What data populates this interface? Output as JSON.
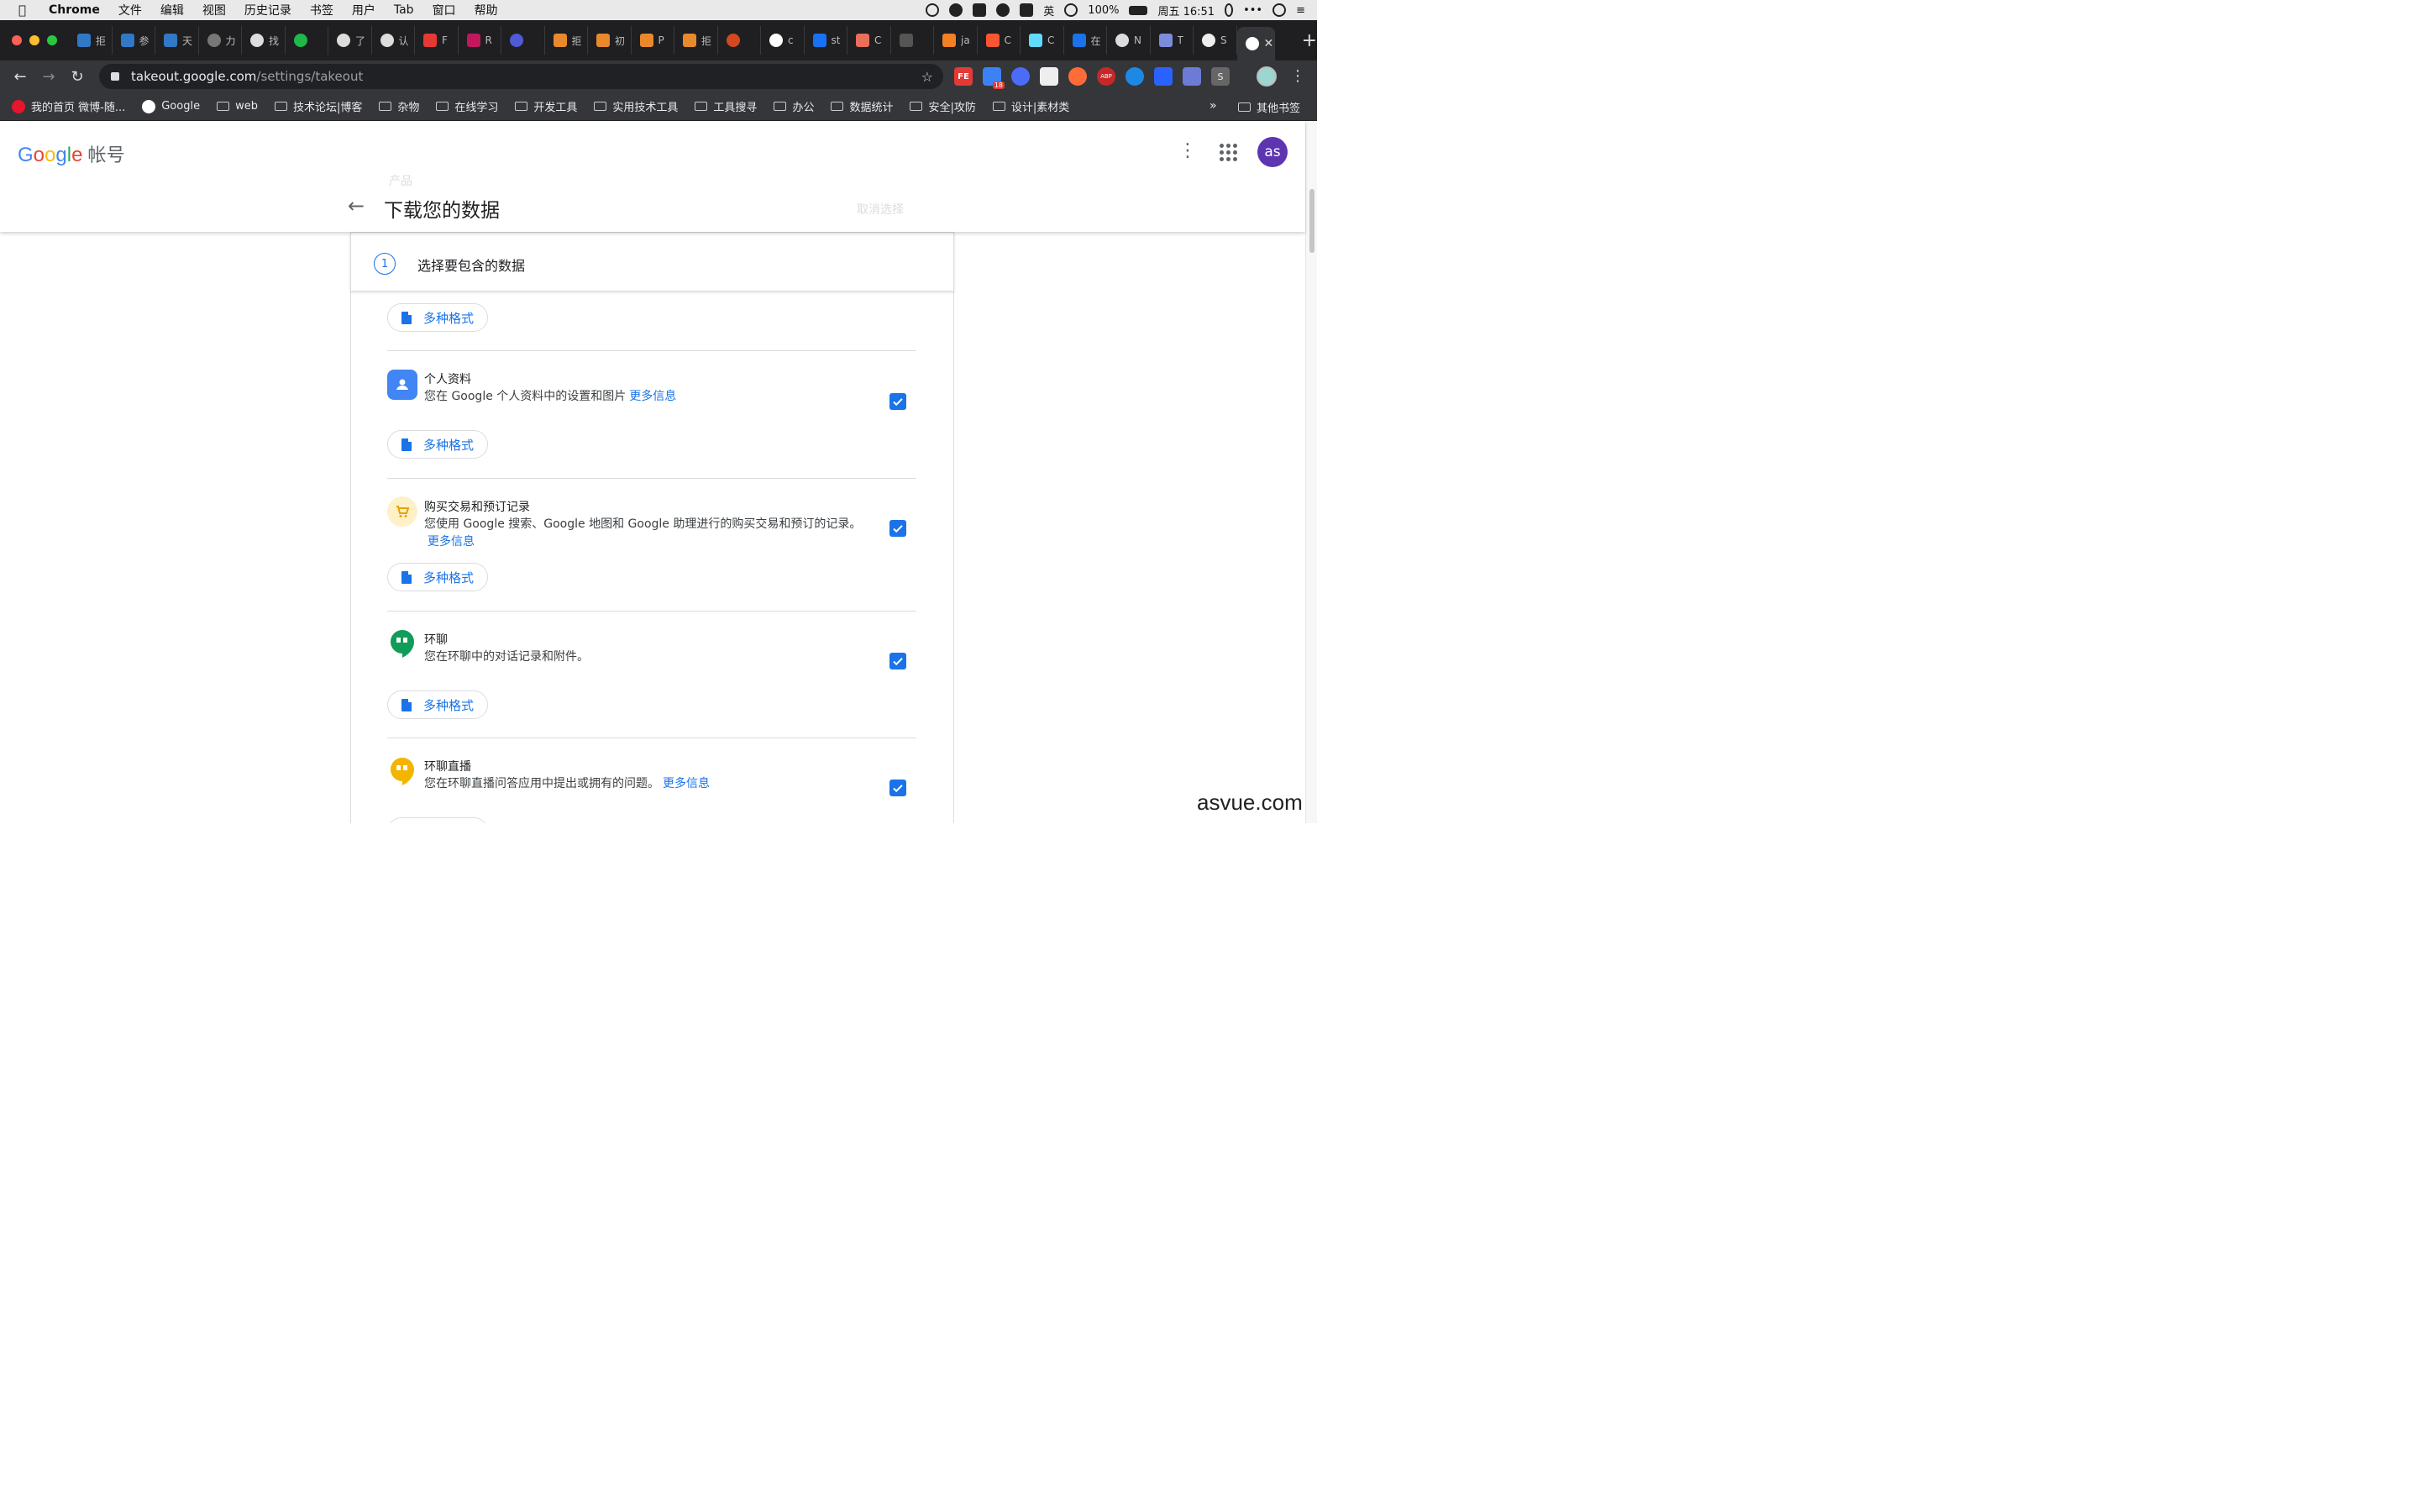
{
  "mac_menu": {
    "app": "Chrome",
    "items": [
      "文件",
      "编辑",
      "视图",
      "历史记录",
      "书签",
      "用户",
      "Tab",
      "窗口",
      "帮助"
    ],
    "ime": "英",
    "battery": "100%",
    "clock": "周五 16:51"
  },
  "tabs": [
    {
      "icon": "ts-icon",
      "color": "#3178c6",
      "text": "拒"
    },
    {
      "icon": "ts-icon",
      "color": "#3178c6",
      "text": "参"
    },
    {
      "icon": "ts-icon",
      "color": "#3178c6",
      "text": "天"
    },
    {
      "icon": "globe-icon",
      "color": "#777777",
      "text": "力"
    },
    {
      "icon": "github-icon",
      "color": "#dddddd",
      "text": "找"
    },
    {
      "icon": "green-dot-icon",
      "color": "#1fb84a",
      "text": ""
    },
    {
      "icon": "github-icon",
      "color": "#dddddd",
      "text": "了"
    },
    {
      "icon": "github-icon",
      "color": "#dddddd",
      "text": "认"
    },
    {
      "icon": "bird-icon",
      "color": "#e53935",
      "text": "F"
    },
    {
      "icon": "r-icon",
      "color": "#c2185b",
      "text": "R"
    },
    {
      "icon": "blue-dot-icon",
      "color": "#4f5bd5",
      "text": ""
    },
    {
      "icon": "mascot-icon",
      "color": "#e8892c",
      "text": "拒"
    },
    {
      "icon": "mascot-icon",
      "color": "#e8892c",
      "text": "初"
    },
    {
      "icon": "mascot-icon",
      "color": "#e8892c",
      "text": "P"
    },
    {
      "icon": "mascot-icon",
      "color": "#e8892c",
      "text": "拒"
    },
    {
      "icon": "orange-dot-icon",
      "color": "#d4491f",
      "text": ""
    },
    {
      "icon": "google-icon",
      "color": "#ffffff",
      "text": "c"
    },
    {
      "icon": "zhihu-icon",
      "color": "#1772f6",
      "text": "st"
    },
    {
      "icon": "jianshu-icon",
      "color": "#ea6f5a",
      "text": "C"
    },
    {
      "icon": "hand-icon",
      "color": "#555555",
      "text": ""
    },
    {
      "icon": "stack-icon",
      "color": "#f48024",
      "text": "ja"
    },
    {
      "icon": "csdn-icon",
      "color": "#fc5531",
      "text": "C"
    },
    {
      "icon": "react-icon",
      "color": "#61dafb",
      "text": "C"
    },
    {
      "icon": "braces-icon",
      "color": "#1a73e8",
      "text": "在"
    },
    {
      "icon": "github-icon",
      "color": "#dddddd",
      "text": "N"
    },
    {
      "icon": "gitlab-icon",
      "color": "#7b8cde",
      "text": "T"
    },
    {
      "icon": "globe-icon",
      "color": "#eeeeee",
      "text": "S"
    }
  ],
  "active_tab": {
    "icon": "google-icon",
    "close": "✕"
  },
  "new_tab": "+",
  "address": {
    "host": "takeout.google.com",
    "path": "/settings/takeout"
  },
  "bookmarks": [
    {
      "icon": "weibo-icon",
      "label": "我的首页 微博-随..."
    },
    {
      "icon": "google-icon",
      "label": "Google"
    },
    {
      "icon": "folder-icon",
      "label": "web"
    },
    {
      "icon": "folder-icon",
      "label": "技术论坛|博客"
    },
    {
      "icon": "folder-icon",
      "label": "杂物"
    },
    {
      "icon": "folder-icon",
      "label": "在线学习"
    },
    {
      "icon": "folder-icon",
      "label": "开发工具"
    },
    {
      "icon": "folder-icon",
      "label": "实用技术工具"
    },
    {
      "icon": "folder-icon",
      "label": "工具搜寻"
    },
    {
      "icon": "folder-icon",
      "label": "办公"
    },
    {
      "icon": "folder-icon",
      "label": "数据统计"
    },
    {
      "icon": "folder-icon",
      "label": "安全|攻防"
    },
    {
      "icon": "folder-icon",
      "label": "设计|素材类"
    }
  ],
  "bookmarks_more": "»",
  "bookmarks_other": "其他书签",
  "extensions": {
    "badge": "18",
    "fe_label": "FE",
    "abp_label": "ABP",
    "s_label": "S"
  },
  "header": {
    "logo": [
      "G",
      "o",
      "o",
      "g",
      "l",
      "e"
    ],
    "account": "帐号",
    "avatar": "as",
    "title": "下载您的数据",
    "ghost_products": "产品",
    "ghost_deselect": "取消选择"
  },
  "step": {
    "number": "1",
    "title": "选择要包含的数据"
  },
  "format_label": "多种格式",
  "products": [
    {
      "name": "个人资料",
      "desc": "您在 Google 个人资料中的设置和图片",
      "more": "更多信息",
      "icon": "profile-icon",
      "color": "#4285f4",
      "checked": true
    },
    {
      "name": "购买交易和预订记录",
      "desc": "您使用 Google 搜索、Google 地图和 Google 助理进行的购买交易和预订的记录。",
      "more": "更多信息",
      "icon": "cart-icon",
      "color": "#fbbc05",
      "checked": true
    },
    {
      "name": "环聊",
      "desc": "您在环聊中的对话记录和附件。",
      "more": "",
      "icon": "hangouts-icon",
      "color": "#0f9d58",
      "checked": true
    },
    {
      "name": "环聊直播",
      "desc": "您在环聊直播问答应用中提出或拥有的问题。",
      "more": "更多信息",
      "icon": "hangouts-onair-icon",
      "color": "#f4b400",
      "checked": true
    }
  ],
  "watermark": "asvue.com"
}
